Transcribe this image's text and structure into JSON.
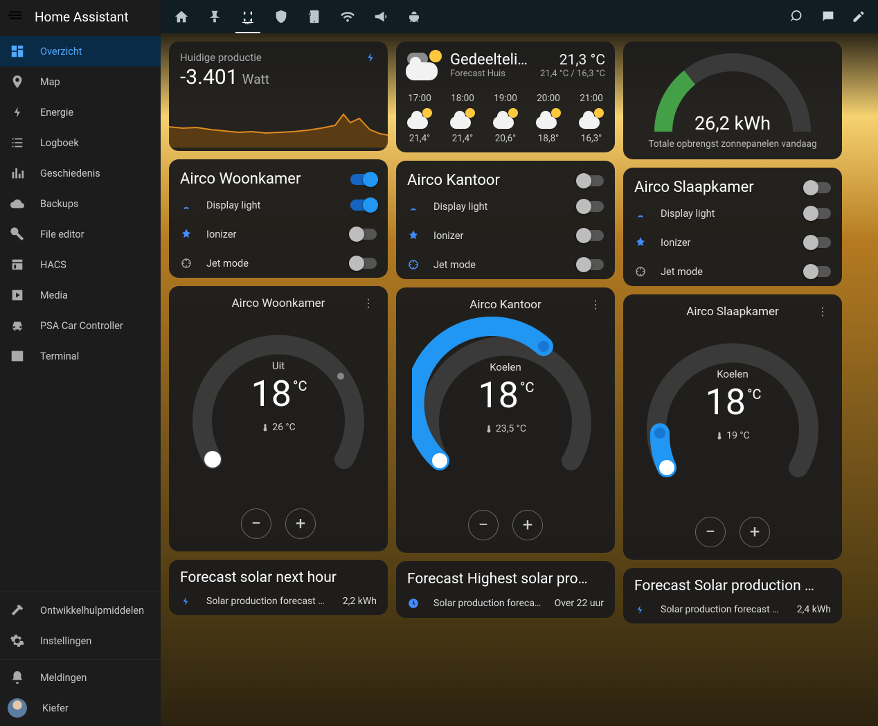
{
  "app_title": "Home Assistant",
  "sidebar": {
    "items": [
      {
        "label": "Overzicht",
        "active": true
      },
      {
        "label": "Map"
      },
      {
        "label": "Energie"
      },
      {
        "label": "Logboek"
      },
      {
        "label": "Geschiedenis"
      },
      {
        "label": "Backups"
      },
      {
        "label": "File editor"
      },
      {
        "label": "HACS"
      },
      {
        "label": "Media"
      },
      {
        "label": "PSA Car Controller"
      },
      {
        "label": "Terminal"
      }
    ],
    "footer": {
      "devtools": "Ontwikkelhulpmiddelen",
      "settings": "Instellingen",
      "notifications": "Meldingen",
      "user": "Kiefer"
    }
  },
  "production": {
    "title": "Huidige productie",
    "value": "-3.401",
    "unit": "Watt"
  },
  "weather": {
    "name": "Gedeelteli…",
    "subtitle": "Forecast Huis",
    "temp": "21,3 °C",
    "range": "21,4 °C / 16,3 °C",
    "hours": [
      {
        "time": "17:00",
        "temp": "21,4°"
      },
      {
        "time": "18:00",
        "temp": "21,4°"
      },
      {
        "time": "19:00",
        "temp": "20,6°"
      },
      {
        "time": "20:00",
        "temp": "18,8°"
      },
      {
        "time": "21:00",
        "temp": "16,3°"
      }
    ]
  },
  "gauge": {
    "value": "26,2 kWh",
    "label": "Totale opbrengst zonnepanelen vandaag",
    "fraction": 0.27
  },
  "ac_woonkamer": {
    "title": "Airco Woonkamer",
    "main_on": true,
    "rows": {
      "display": "Display light",
      "ionizer": "Ionizer",
      "jet": "Jet mode"
    },
    "states": {
      "display": true,
      "ionizer": false,
      "jet": false
    }
  },
  "ac_kantoor": {
    "title": "Airco Kantoor",
    "main_on": false,
    "rows": {
      "display": "Display light",
      "ionizer": "Ionizer",
      "jet": "Jet mode"
    },
    "states": {
      "display": false,
      "ionizer": false,
      "jet": false
    }
  },
  "ac_slaapkamer": {
    "title": "Airco Slaapkamer",
    "main_on": false,
    "rows": {
      "display": "Display light",
      "ionizer": "Ionizer",
      "jet": "Jet mode"
    },
    "states": {
      "display": false,
      "ionizer": false,
      "jet": false
    }
  },
  "thermo_woonkamer": {
    "title": "Airco Woonkamer",
    "state": "Uit",
    "set": "18",
    "deg": "°C",
    "current": "26 °C",
    "cool": false
  },
  "thermo_kantoor": {
    "title": "Airco Kantoor",
    "state": "Koelen",
    "set": "18",
    "deg": "°C",
    "current": "23,5 °C",
    "cool": true
  },
  "thermo_slaapkamer": {
    "title": "Airco Slaapkamer",
    "state": "Koelen",
    "set": "18",
    "deg": "°C",
    "current": "19 °C",
    "cool": true
  },
  "forecast_next_hour": {
    "title": "Forecast solar next hour",
    "row_label": "Solar production forecast G…",
    "row_value": "2,2 kWh"
  },
  "forecast_highest": {
    "title": "Forecast Highest solar pro…",
    "row_label": "Solar production foreca…",
    "row_value": "Over 22 uur"
  },
  "forecast_today": {
    "title": "Forecast Solar production …",
    "row_label": "Solar production forecast G…",
    "row_value": "2,4 kWh"
  },
  "chart_data": {
    "type": "area",
    "title": "Huidige productie",
    "ylabel": "Watt",
    "x": [
      0,
      1,
      2,
      3,
      4,
      5,
      6,
      7,
      8,
      9,
      10,
      11,
      12,
      13,
      14,
      15,
      16,
      17,
      18,
      19,
      20,
      21,
      22,
      23,
      24,
      25,
      26,
      27,
      28,
      29,
      30
    ],
    "values": [
      -3300,
      -3320,
      -3340,
      -3310,
      -3350,
      -3380,
      -3400,
      -3410,
      -3450,
      -3440,
      -3460,
      -3470,
      -3480,
      -3460,
      -3440,
      -3450,
      -3430,
      -3410,
      -3380,
      -3350,
      -3320,
      -3280,
      -3230,
      -3180,
      -3120,
      -3050,
      -3000,
      -3100,
      -3250,
      -3350,
      -3401
    ],
    "ylim": [
      -3600,
      -2900
    ]
  }
}
